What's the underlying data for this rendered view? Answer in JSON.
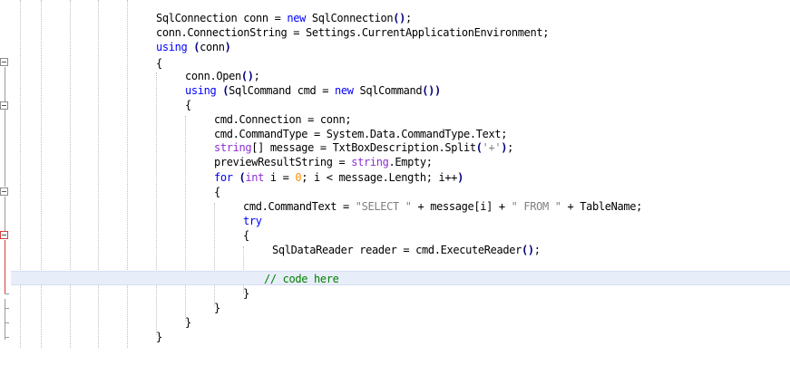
{
  "editor": {
    "lines": [
      {
        "text": "SqlConnection conn = new SqlConnection();"
      },
      {
        "text": "conn.ConnectionString = Settings.CurrentApplicationEnvironment;"
      },
      {
        "text": "using (conn)"
      },
      {
        "text": "{"
      },
      {
        "text": "conn.Open();"
      },
      {
        "text": "using (SqlCommand cmd = new SqlCommand())"
      },
      {
        "text": "{"
      },
      {
        "text": "cmd.Connection = conn;"
      },
      {
        "text": "cmd.CommandType = System.Data.CommandType.Text;"
      },
      {
        "text": "string[] message = TxtBoxDescription.Split('+');"
      },
      {
        "text": "previewResultString = string.Empty;"
      },
      {
        "text": "for (int i = 0; i < message.Length; i++)"
      },
      {
        "text": "{"
      },
      {
        "text": "cmd.CommandText = \"SELECT \" + message[i] + \" FROM \" + TableName;"
      },
      {
        "text": "try"
      },
      {
        "text": "{"
      },
      {
        "text": "SqlDataReader reader = cmd.ExecuteReader();"
      },
      {
        "text": ""
      },
      {
        "text": "// code here"
      },
      {
        "text": "}"
      },
      {
        "text": "}"
      },
      {
        "text": "}"
      },
      {
        "text": "}"
      }
    ],
    "colors": {
      "keyword": "#0000ff",
      "type": "#8b2fd1",
      "number": "#ff8c00",
      "string": "#808080",
      "comment": "#008000",
      "current_line": "#e8eef9"
    }
  }
}
